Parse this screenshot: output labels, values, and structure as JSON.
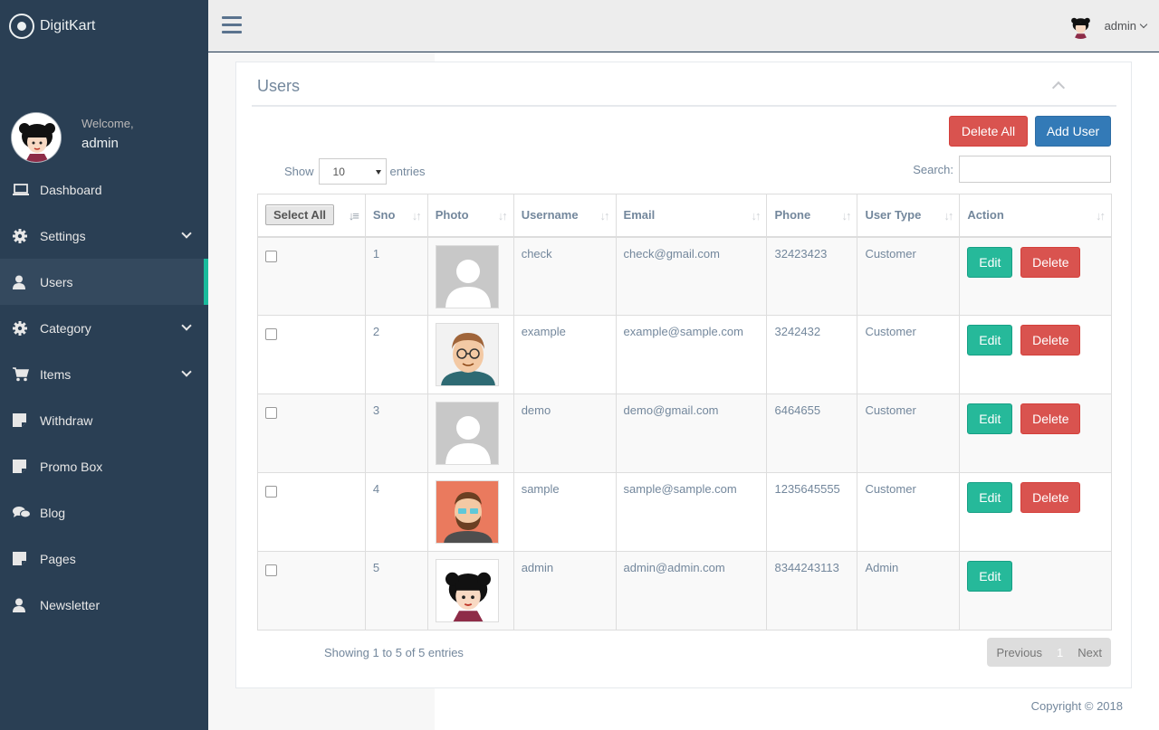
{
  "brand": {
    "name": "DigitKart"
  },
  "profile": {
    "welcome": "Welcome,",
    "name": "admin"
  },
  "sidebar": {
    "items": [
      {
        "label": "Dashboard",
        "icon": "laptop-icon"
      },
      {
        "label": "Settings",
        "icon": "gear-icon",
        "expandable": true
      },
      {
        "label": "Users",
        "icon": "user-icon",
        "active": true
      },
      {
        "label": "Category",
        "icon": "gear-icon",
        "expandable": true
      },
      {
        "label": "Items",
        "icon": "cart-icon",
        "expandable": true
      },
      {
        "label": "Withdraw",
        "icon": "note-icon"
      },
      {
        "label": "Promo Box",
        "icon": "note-icon"
      },
      {
        "label": "Blog",
        "icon": "comments-icon"
      },
      {
        "label": "Pages",
        "icon": "note-icon"
      },
      {
        "label": "Newsletter",
        "icon": "user-icon"
      }
    ]
  },
  "topnav": {
    "username": "admin"
  },
  "panel": {
    "title": "Users",
    "delete_all_label": "Delete All",
    "add_user_label": "Add User",
    "show_label": "Show",
    "entries_value": "10",
    "entries_label": "entries",
    "search_label": "Search:",
    "search_value": ""
  },
  "table": {
    "select_all_label": "Select All",
    "headers": [
      "Sno",
      "Photo",
      "Username",
      "Email",
      "Phone",
      "User Type",
      "Action"
    ],
    "edit_label": "Edit",
    "delete_label": "Delete",
    "rows": [
      {
        "sno": "1",
        "photo": "default-avatar",
        "username": "check",
        "email": "check@gmail.com",
        "phone": "32423423",
        "type": "Customer",
        "deletable": true
      },
      {
        "sno": "2",
        "photo": "man-glasses-avatar",
        "username": "example",
        "email": "example@sample.com",
        "phone": "3242432",
        "type": "Customer",
        "deletable": true
      },
      {
        "sno": "3",
        "photo": "default-avatar",
        "username": "demo",
        "email": "demo@gmail.com",
        "phone": "6464655",
        "type": "Customer",
        "deletable": true
      },
      {
        "sno": "4",
        "photo": "bearded-man-avatar",
        "username": "sample",
        "email": "sample@sample.com",
        "phone": "1235645555",
        "type": "Customer",
        "deletable": true
      },
      {
        "sno": "5",
        "photo": "geisha-avatar",
        "username": "admin",
        "email": "admin@admin.com",
        "phone": "8344243113",
        "type": "Admin",
        "deletable": false
      }
    ]
  },
  "pagination": {
    "info": "Showing 1 to 5 of 5 entries",
    "previous": "Previous",
    "current": "1",
    "next": "Next"
  },
  "footer": {
    "copyright": "Copyright © 2018"
  },
  "colors": {
    "sidebar_bg": "#2a3f54",
    "accent": "#1abb9c",
    "danger": "#d9534f",
    "primary": "#337ab7",
    "success": "#26b99a"
  }
}
